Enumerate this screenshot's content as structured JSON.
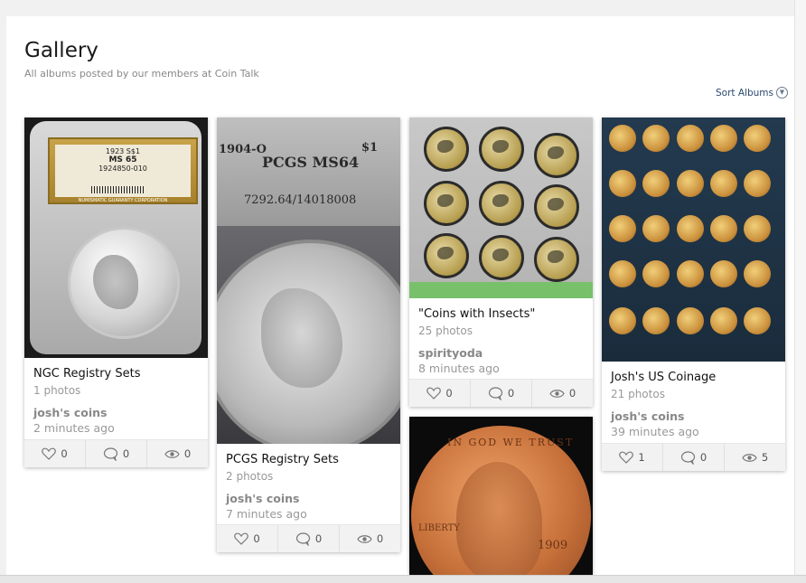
{
  "header": {
    "title": "Gallery",
    "subtitle": "All albums posted by our members at Coin Talk",
    "sort_label": "Sort Albums"
  },
  "albums": [
    {
      "title": "NGC Registry Sets",
      "photos": "1 photos",
      "user": "josh's coins",
      "time": "2 minutes ago",
      "likes": "0",
      "comments": "0",
      "views": "0",
      "image_text": {
        "line1": "1923 S$1",
        "line2": "MS 65",
        "line3": "1924850-010",
        "line4": "NUMISMATIC GUARANTY CORPORATION"
      }
    },
    {
      "title": "PCGS Registry Sets",
      "photos": "2 photos",
      "user": "josh's coins",
      "time": "7 minutes ago",
      "likes": "0",
      "comments": "0",
      "views": "0",
      "image_text": {
        "line1": "1904-O",
        "line2": "$1",
        "line3": "PCGS MS64",
        "line4": "7292.64/14018008"
      }
    },
    {
      "title": "\"Coins with Insects\"",
      "photos": "25 photos",
      "user": "spirityoda",
      "time": "8 minutes ago",
      "likes": "0",
      "comments": "0",
      "views": "0"
    },
    {
      "title": "Josh's US Coinage",
      "photos": "21 photos",
      "user": "josh's coins",
      "time": "39 minutes ago",
      "likes": "1",
      "comments": "0",
      "views": "5"
    }
  ],
  "fifth_album_image_text": {
    "top": "IN GOD WE TRUST",
    "side": "LIBERTY",
    "year": "1909"
  },
  "icons": [
    "heart-icon",
    "comment-icon",
    "eye-icon",
    "chevron-down-circle-icon"
  ]
}
